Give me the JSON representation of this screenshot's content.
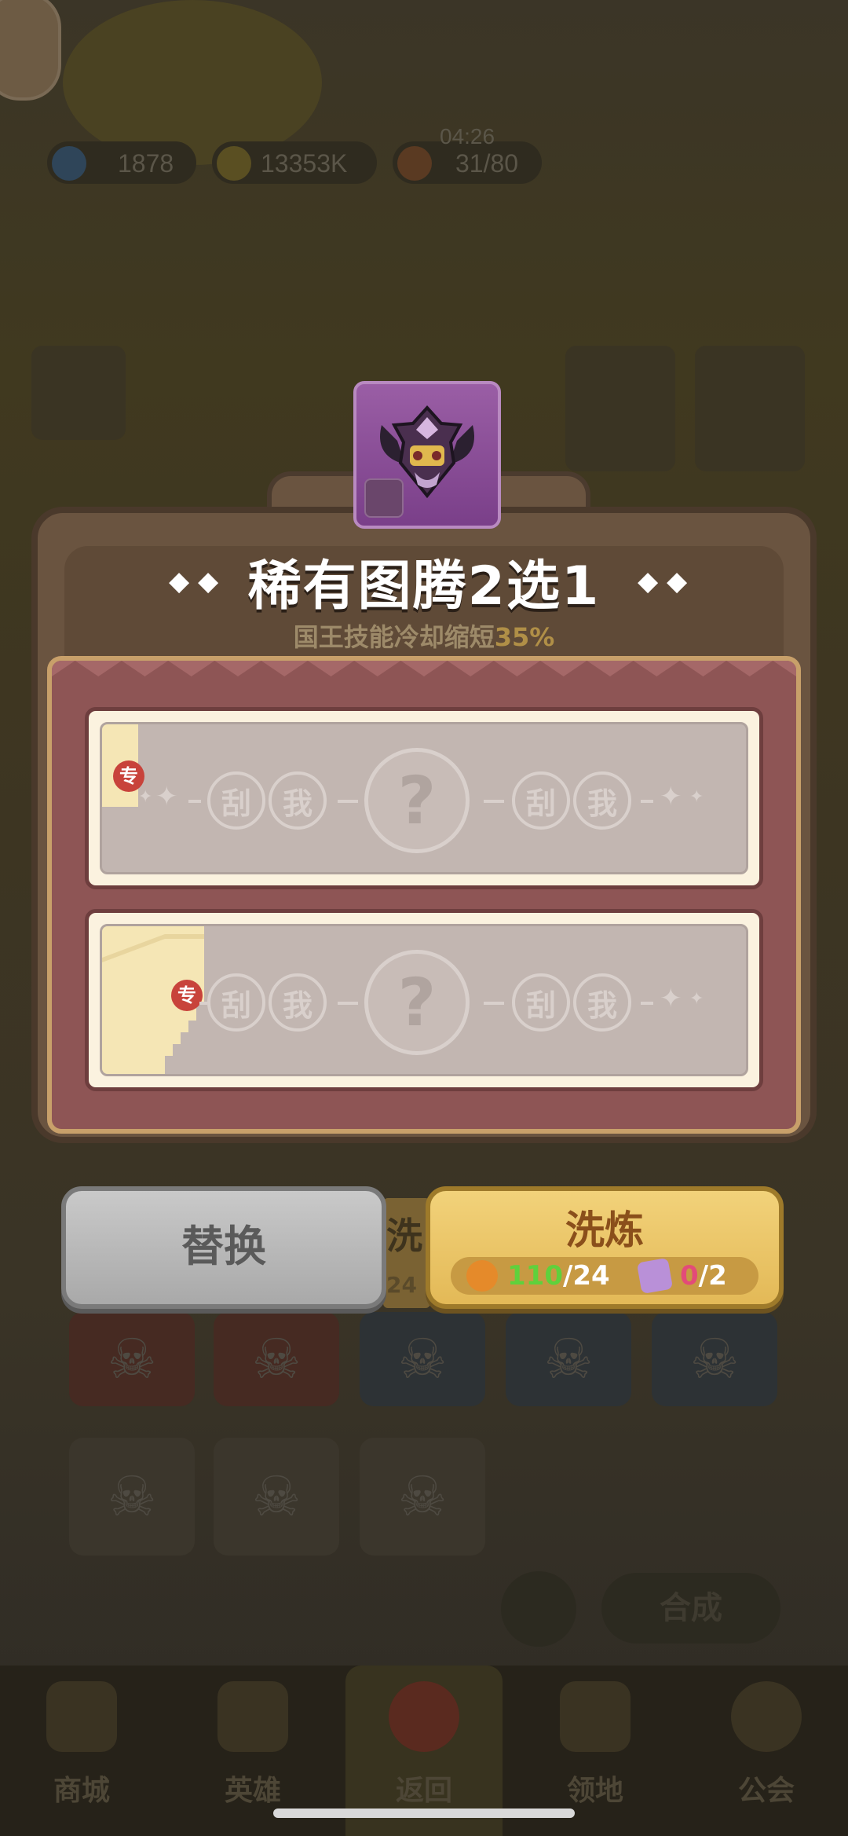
{
  "background": {
    "resources": [
      {
        "name": "gems",
        "value": "1878"
      },
      {
        "name": "gold",
        "value": "13353K"
      },
      {
        "name": "stamina",
        "value": "31/80"
      }
    ],
    "timer": "04:26",
    "fusion_button": "合成",
    "bottom_nav": [
      {
        "label": "商城"
      },
      {
        "label": "英雄"
      },
      {
        "label": "返回"
      },
      {
        "label": "领地"
      },
      {
        "label": "公会"
      }
    ]
  },
  "modal": {
    "title": "稀有图腾2选1",
    "subtitle_prefix": "国王技能冷却缩短",
    "subtitle_value": "35%",
    "options": [
      {
        "badge": "专",
        "scratch_left": [
          "刮",
          "我"
        ],
        "mystery": "?",
        "scratch_right": [
          "刮",
          "我"
        ]
      },
      {
        "badge": "专",
        "scratch_left": [
          "刮",
          "我"
        ],
        "mystery": "?",
        "scratch_right": [
          "刮",
          "我"
        ]
      }
    ],
    "replace_button": "替换",
    "refine_button": "洗炼",
    "refine_cost": {
      "item1_have": "110",
      "item1_need": "/24",
      "item2_have": "0",
      "item2_need": "/2"
    },
    "background_button_peek": {
      "label": "洗",
      "count": "24"
    },
    "colors": {
      "accent_gold": "#e3b957",
      "board_red": "#8e5555",
      "have_ok": "#5fd13c",
      "have_insufficient": "#e34b79"
    }
  }
}
